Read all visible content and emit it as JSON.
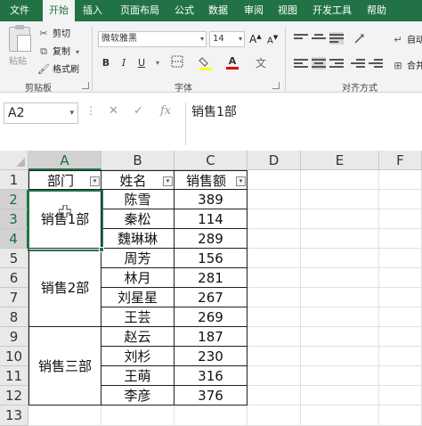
{
  "ribbon_tabs": [
    "文件",
    "开始",
    "插入",
    "页面布局",
    "公式",
    "数据",
    "审阅",
    "视图",
    "开发工具",
    "帮助"
  ],
  "active_tab": "开始",
  "clipboard": {
    "paste_label": "粘贴",
    "cut_label": "剪切",
    "copy_label": "复制",
    "format_painter_label": "格式刷",
    "group_label": "剪贴板"
  },
  "font": {
    "name": "微软雅黑",
    "size": "14",
    "group_label": "字体",
    "bold": "B",
    "italic": "I",
    "underline": "U",
    "grow": "A",
    "shrink": "A"
  },
  "alignment": {
    "group_label": "对齐方式",
    "wrap_label": "自动",
    "merge_label": "合并"
  },
  "formula_bar": {
    "name_box": "A2",
    "content": "销售1部",
    "fx": "fx"
  },
  "columns": [
    "A",
    "B",
    "C",
    "D",
    "E",
    "F"
  ],
  "rows": [
    "1",
    "2",
    "3",
    "4",
    "5",
    "6",
    "7",
    "8",
    "9",
    "10",
    "11",
    "12",
    "13"
  ],
  "headers": [
    "部门",
    "姓名",
    "销售额"
  ],
  "departments": [
    {
      "name": "销售1部",
      "rows": 3
    },
    {
      "name": "销售2部",
      "rows": 4
    },
    {
      "name": "销售三部",
      "rows": 4
    }
  ],
  "names": [
    "陈雪",
    "秦松",
    "魏琳琳",
    "周芳",
    "林月",
    "刘星星",
    "王芸",
    "赵云",
    "刘杉",
    "王萌",
    "李彦"
  ],
  "sales": [
    "389",
    "114",
    "289",
    "156",
    "281",
    "267",
    "269",
    "187",
    "230",
    "316",
    "376"
  ],
  "colors": {
    "accent": "#217346",
    "ribbon_bg": "#f3f3f3",
    "grid_header_bg": "#e9e9e9",
    "font_color_bar": "#e00000",
    "highlight_bar": "#ffff00"
  },
  "icons": {
    "cut": "scissors-icon",
    "copy": "copy-icon",
    "format_painter": "paintbrush-icon",
    "cancel": "cancel-icon",
    "confirm": "check-icon",
    "insert_function": "fx-icon"
  }
}
